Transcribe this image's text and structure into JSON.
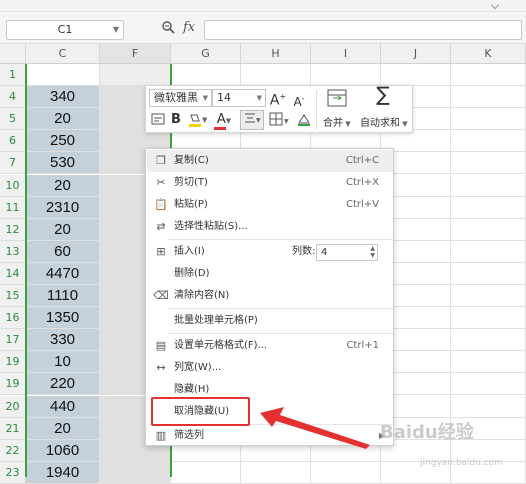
{
  "formula_bar": {
    "name_box": "C1",
    "fx_label": "fx",
    "formula": ""
  },
  "columns": [
    "C",
    "F",
    "G",
    "H",
    "I",
    "J",
    "K"
  ],
  "rows": [
    {
      "num": "1",
      "c": ""
    },
    {
      "num": "4",
      "c": "340"
    },
    {
      "num": "5",
      "c": "20"
    },
    {
      "num": "6",
      "c": "250"
    },
    {
      "num": "7",
      "c": "530"
    },
    {
      "num": "10",
      "c": "20"
    },
    {
      "num": "11",
      "c": "2310"
    },
    {
      "num": "12",
      "c": "20"
    },
    {
      "num": "13",
      "c": "60"
    },
    {
      "num": "14",
      "c": "4470"
    },
    {
      "num": "15",
      "c": "1110"
    },
    {
      "num": "16",
      "c": "1350"
    },
    {
      "num": "17",
      "c": "330"
    },
    {
      "num": "19",
      "c": "10"
    },
    {
      "num": "19",
      "c": "220"
    },
    {
      "num": "20",
      "c": "440"
    },
    {
      "num": "21",
      "c": "20"
    },
    {
      "num": "22",
      "c": "1060"
    },
    {
      "num": "23",
      "c": "1940"
    }
  ],
  "mini_toolbar": {
    "font_name": "微软雅黑",
    "font_size": "14",
    "increase_font": "A",
    "decrease_font": "A",
    "bold": "B",
    "font_color": "A",
    "merge_label": "合并",
    "autosum_label": "自动求和"
  },
  "context_menu": {
    "copy": {
      "label": "复制(C)",
      "shortcut": "Ctrl+C"
    },
    "cut": {
      "label": "剪切(T)",
      "shortcut": "Ctrl+X"
    },
    "paste": {
      "label": "粘贴(P)",
      "shortcut": "Ctrl+V"
    },
    "paste_special": {
      "label": "选择性粘贴(S)..."
    },
    "insert": {
      "label": "插入(I)",
      "count_label": "列数:",
      "count_value": "4"
    },
    "delete": {
      "label": "删除(D)"
    },
    "clear": {
      "label": "清除内容(N)"
    },
    "batch": {
      "label": "批量处理单元格(P)"
    },
    "format_cells": {
      "label": "设置单元格格式(F)...",
      "shortcut": "Ctrl+1"
    },
    "column_width": {
      "label": "列宽(W)..."
    },
    "hide": {
      "label": "隐藏(H)"
    },
    "unhide": {
      "label": "取消隐藏(U)"
    },
    "filter": {
      "label": "筛选列"
    }
  },
  "watermark": "Baidu经验",
  "watermark_sub": "jingyan.baidu.com",
  "colors": {
    "accent_green": "#3ca23c",
    "highlight_red": "#e53030",
    "selection_fill": "#c4d0da"
  }
}
